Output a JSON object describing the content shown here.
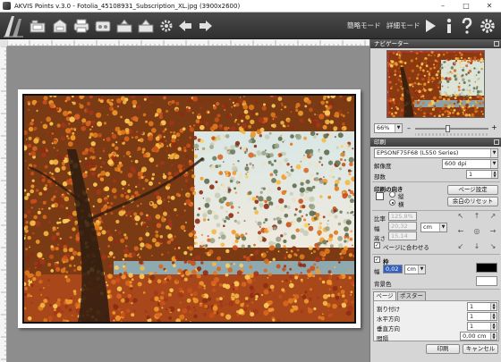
{
  "window": {
    "title": "AKVIS Points v.3.0 - Fotolia_45108931_Subscription_XL.jpg (3900x2600)"
  },
  "toolbar": {
    "quick_mode": "簡略モード",
    "detail_mode": "詳細モード"
  },
  "navigator": {
    "title": "ナビゲーター",
    "zoom": "66%"
  },
  "print": {
    "section_title": "印刷",
    "printer": "EPSONF75F68 (L550 Series)",
    "resolution_label": "解像度",
    "resolution": "600 dpi",
    "copies_label": "部数",
    "copies": "1",
    "orientation_title": "印刷の向き",
    "portrait": "縦",
    "landscape": "横",
    "page_setup_button": "ページ設定",
    "margins_reset_button": "余白のリセット",
    "scale_label": "比率",
    "scale_value": "125.8%",
    "width_label": "幅",
    "width_value": "20,32",
    "height_label": "高さ",
    "height_value": "15,14",
    "unit": "cm",
    "fit_to_page": "ページに合わせる",
    "frame_label": "枠",
    "frame_width_label": "幅",
    "frame_width": "0,02",
    "frame_unit": "cm",
    "frame_color": "#000000",
    "bg_color_label": "背景色",
    "bg_color": "#ffffff"
  },
  "page_tabs": {
    "tab_page": "ページ",
    "tab_poster": "ポスター",
    "split_label": "割り付け",
    "split_value": "1",
    "horizontal_label": "水平方向",
    "horizontal_value": "1",
    "vertical_label": "垂直方向",
    "vertical_value": "1",
    "gap_label": "間隔",
    "gap_value": "0,00 cm"
  },
  "footer": {
    "print_button": "印刷",
    "cancel_button": "キャンセル"
  },
  "colors": {
    "panel_header": "#4a4a4a",
    "toolbar": "#3c3c3c",
    "workspace": "#8d8d8d"
  }
}
